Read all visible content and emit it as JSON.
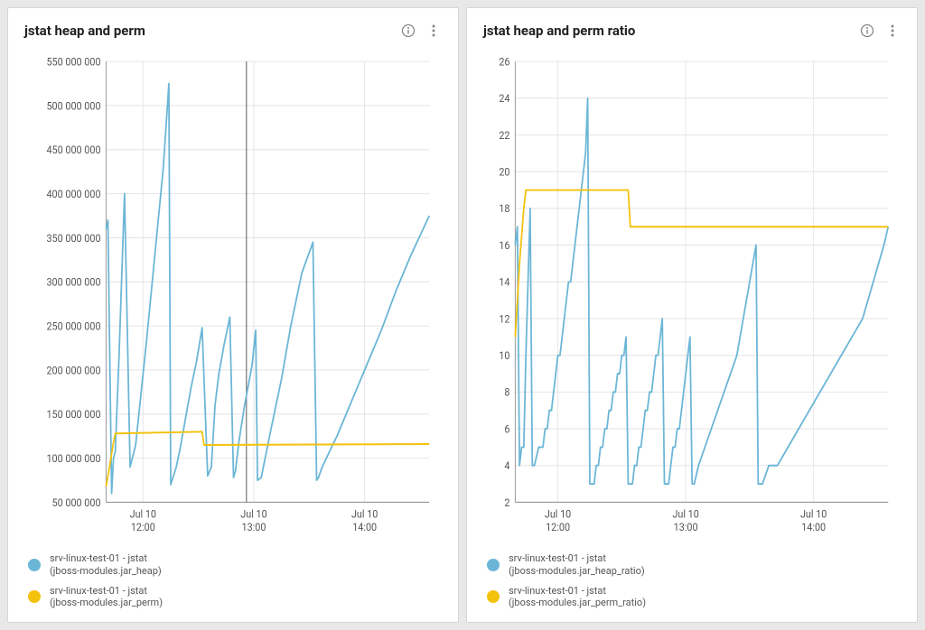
{
  "panels": [
    {
      "title": "jstat heap and perm",
      "legend": [
        {
          "label": "srv-linux-test-01 - jstat",
          "sublabel": "(jboss-modules.jar_heap)",
          "color": "#6bb6d6"
        },
        {
          "label": "srv-linux-test-01 - jstat",
          "sublabel": "(jboss-modules.jar_perm)",
          "color": "#f4c20d"
        }
      ]
    },
    {
      "title": "jstat heap and perm ratio",
      "legend": [
        {
          "label": "srv-linux-test-01 - jstat",
          "sublabel": "(jboss-modules.jar_heap_ratio)",
          "color": "#6bb6d6"
        },
        {
          "label": "srv-linux-test-01 - jstat",
          "sublabel": "(jboss-modules.jar_perm_ratio)",
          "color": "#f4c20d"
        }
      ]
    }
  ],
  "chart_data": [
    {
      "type": "line",
      "title": "jstat heap and perm",
      "xlabel": "",
      "ylabel": "",
      "ylim": [
        50000000,
        550000000
      ],
      "y_ticks": [
        50000000,
        100000000,
        150000000,
        200000000,
        250000000,
        300000000,
        350000000,
        400000000,
        450000000,
        500000000,
        550000000
      ],
      "y_tick_format": "### ### ###",
      "x_ticks": [
        "Jul 10\n12:00",
        "Jul 10\n13:00",
        "Jul 10\n14:00"
      ],
      "x_range_minutes": [
        20,
        195
      ],
      "cursor_x_minute": 96,
      "series": [
        {
          "name": "heap",
          "color": "#6bb6d6",
          "x_minutes": [
            20,
            21,
            23,
            24,
            25,
            27,
            30,
            33,
            36,
            39,
            42,
            45,
            48,
            51,
            54,
            55,
            58,
            60,
            63,
            66,
            69,
            72,
            75,
            77,
            78,
            79,
            81,
            84,
            87,
            89,
            90,
            92,
            95,
            99,
            101,
            102,
            104,
            109,
            115,
            120,
            126,
            132,
            134,
            135,
            137,
            145,
            153,
            161,
            169,
            177,
            185,
            195
          ],
          "values": [
            360000000,
            370000000,
            60000000,
            100000000,
            108000000,
            215000000,
            400000000,
            90000000,
            115000000,
            175000000,
            235000000,
            300000000,
            365000000,
            430000000,
            525000000,
            70000000,
            90000000,
            110000000,
            145000000,
            180000000,
            210000000,
            248000000,
            80000000,
            90000000,
            125000000,
            160000000,
            195000000,
            230000000,
            260000000,
            78000000,
            85000000,
            120000000,
            160000000,
            205000000,
            245000000,
            75000000,
            78000000,
            130000000,
            190000000,
            250000000,
            310000000,
            345000000,
            75000000,
            78000000,
            90000000,
            125000000,
            165000000,
            205000000,
            245000000,
            290000000,
            330000000,
            375000000
          ]
        },
        {
          "name": "perm",
          "color": "#f4c20d",
          "x_minutes": [
            20,
            22,
            24,
            25,
            72,
            73,
            195
          ],
          "values": [
            68000000,
            92000000,
            118000000,
            128000000,
            130000000,
            115000000,
            116000000
          ]
        }
      ]
    },
    {
      "type": "line",
      "title": "jstat heap and perm ratio",
      "xlabel": "",
      "ylabel": "",
      "ylim": [
        2,
        26
      ],
      "y_ticks": [
        2,
        4,
        6,
        8,
        10,
        12,
        14,
        16,
        18,
        20,
        22,
        24,
        26
      ],
      "x_ticks": [
        "Jul 10\n12:00",
        "Jul 10\n13:00",
        "Jul 10\n14:00"
      ],
      "x_range_minutes": [
        20,
        195
      ],
      "series": [
        {
          "name": "heap_ratio",
          "color": "#6bb6d6",
          "x_minutes": [
            20,
            21,
            22,
            23,
            24,
            25,
            27,
            28,
            29,
            31,
            33,
            34,
            35,
            36,
            37,
            38,
            39,
            40,
            41,
            42,
            43,
            44,
            45,
            46,
            47,
            48,
            49,
            50,
            51,
            52,
            53,
            54,
            55,
            56,
            57,
            58,
            59,
            60,
            61,
            62,
            63,
            64,
            65,
            66,
            67,
            68,
            69,
            70,
            71,
            72,
            73,
            74,
            75,
            76,
            77,
            78,
            79,
            80,
            81,
            82,
            83,
            84,
            85,
            86,
            87,
            88,
            89,
            90,
            91,
            92,
            93,
            94,
            95,
            96,
            97,
            98,
            99,
            100,
            101,
            102,
            103,
            104,
            106,
            109,
            112,
            115,
            118,
            121,
            124,
            127,
            130,
            133,
            134,
            135,
            136,
            139,
            143,
            148,
            153,
            158,
            163,
            168,
            173,
            178,
            183,
            188,
            193,
            195
          ],
          "values": [
            16,
            17,
            4,
            5,
            5,
            10,
            18,
            4,
            4,
            5,
            5,
            6,
            6,
            7,
            7,
            8,
            9,
            10,
            10,
            11,
            12,
            13,
            14,
            14,
            15,
            16,
            17,
            18,
            19,
            20,
            21,
            24,
            3,
            3,
            3,
            4,
            4,
            5,
            5,
            6,
            6,
            7,
            7,
            8,
            8,
            9,
            9,
            10,
            10,
            11,
            3,
            3,
            3,
            4,
            4,
            5,
            5,
            6,
            7,
            7,
            8,
            8,
            9,
            10,
            10,
            11,
            12,
            3,
            3,
            3,
            4,
            5,
            5,
            6,
            6,
            7,
            8,
            9,
            10,
            11,
            3,
            3,
            4,
            5,
            6,
            7,
            8,
            9,
            10,
            12,
            14,
            16,
            3,
            3,
            3,
            4,
            4,
            5,
            6,
            7,
            8,
            9,
            10,
            11,
            12,
            14,
            16,
            17
          ]
        },
        {
          "name": "perm_ratio",
          "color": "#f4c20d",
          "x_minutes": [
            20,
            22,
            24,
            25,
            73,
            74,
            195
          ],
          "values": [
            11,
            15,
            18,
            19,
            19,
            17,
            17
          ]
        }
      ]
    }
  ],
  "colors": {
    "heap": "#6bb6d6",
    "perm": "#f4c20d",
    "grid": "#e6e6e6",
    "axis": "#999999"
  }
}
